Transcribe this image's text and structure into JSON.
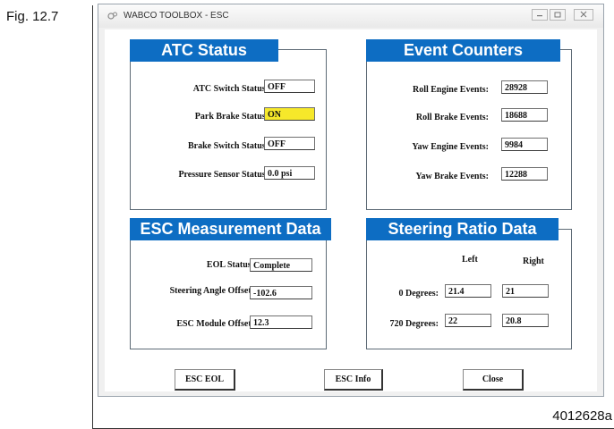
{
  "figure": {
    "label": "Fig. 12.7",
    "id": "4012628a"
  },
  "window": {
    "title": "WABCO TOOLBOX - ESC",
    "icon": "wabco-app-icon",
    "controls": [
      "minimize-icon",
      "restore-icon",
      "close-icon"
    ]
  },
  "atc_status": {
    "title": "ATC Status",
    "rows": [
      {
        "label": "ATC Switch Status:",
        "value": "OFF"
      },
      {
        "label": "Park Brake Status:",
        "value": "ON",
        "highlight": "#f6e82a"
      },
      {
        "label": "Brake Switch Status:",
        "value": "OFF"
      },
      {
        "label": "Pressure Sensor Status:",
        "value": "0.0 psi"
      }
    ]
  },
  "event_counters": {
    "title": "Event Counters",
    "rows": [
      {
        "label": "Roll Engine Events:",
        "value": "28928"
      },
      {
        "label": "Roll Brake Events:",
        "value": "18688"
      },
      {
        "label": "Yaw Engine Events:",
        "value": "9984"
      },
      {
        "label": "Yaw Brake Events:",
        "value": "12288"
      }
    ]
  },
  "esc_measurement": {
    "title": "ESC Measurement Data",
    "rows": [
      {
        "label": "EOL Status:",
        "value": "Complete"
      },
      {
        "label": "Steering Angle Offset:",
        "value": "-102.6"
      },
      {
        "label": "ESC Module Offset:",
        "value": "12.3"
      }
    ]
  },
  "steering_ratio": {
    "title": "Steering Ratio Data",
    "columns": [
      "Left",
      "Right"
    ],
    "rows": [
      {
        "label": "0 Degrees:",
        "left": "21.4",
        "right": "21"
      },
      {
        "label": "720 Degrees:",
        "left": "22",
        "right": "20.8"
      }
    ]
  },
  "buttons": {
    "esc_eol": "ESC EOL",
    "esc_info": "ESC Info",
    "close": "Close"
  },
  "colors": {
    "header_blue": "#0d6dc3",
    "highlight_yellow": "#f6e82a"
  }
}
